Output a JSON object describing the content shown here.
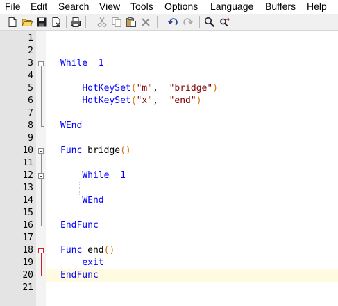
{
  "menu": [
    "File",
    "Edit",
    "Search",
    "View",
    "Tools",
    "Options",
    "Language",
    "Buffers",
    "Help"
  ],
  "toolbar": [
    {
      "icon": "new-file-icon",
      "title": "New"
    },
    {
      "icon": "open-folder-icon",
      "title": "Open"
    },
    {
      "icon": "save-icon",
      "title": "Save"
    },
    {
      "icon": "close-file-icon",
      "title": "Close"
    },
    {
      "icon": "print-icon",
      "title": "Print"
    },
    {
      "icon": "cut-icon",
      "title": "Cut"
    },
    {
      "icon": "copy-icon",
      "title": "Copy"
    },
    {
      "icon": "paste-icon",
      "title": "Paste"
    },
    {
      "icon": "delete-icon",
      "title": "Delete"
    },
    {
      "icon": "undo-icon",
      "title": "Undo"
    },
    {
      "icon": "redo-icon",
      "title": "Redo"
    },
    {
      "icon": "find-icon",
      "title": "Find"
    },
    {
      "icon": "replace-icon",
      "title": "Replace"
    }
  ],
  "editor": {
    "line_numbers": [
      "1",
      "2",
      "3",
      "4",
      "5",
      "6",
      "7",
      "8",
      "9",
      "10",
      "11",
      "12",
      "13",
      "14",
      "15",
      "16",
      "17",
      "18",
      "19",
      "20",
      "21"
    ],
    "current_line": 20,
    "lines": [
      {
        "n": 3,
        "tokens": [
          [
            "kw",
            "While"
          ],
          [
            "",
            "  "
          ],
          [
            "kw",
            "1"
          ]
        ]
      },
      {
        "n": 5,
        "tokens": [
          [
            "",
            "    "
          ],
          [
            "kw",
            "HotKeySet"
          ],
          [
            "par",
            "("
          ],
          [
            "str",
            "\"m\""
          ],
          [
            "",
            ",  "
          ],
          [
            "str",
            "\"bridge\""
          ],
          [
            "par",
            ")"
          ]
        ]
      },
      {
        "n": 6,
        "tokens": [
          [
            "",
            "    "
          ],
          [
            "kw",
            "HotKeySet"
          ],
          [
            "par",
            "("
          ],
          [
            "str",
            "\"x\""
          ],
          [
            "",
            ",  "
          ],
          [
            "str",
            "\"end\""
          ],
          [
            "par",
            ")"
          ]
        ]
      },
      {
        "n": 8,
        "tokens": [
          [
            "kw",
            "WEnd"
          ]
        ]
      },
      {
        "n": 10,
        "tokens": [
          [
            "kw",
            "Func"
          ],
          [
            "",
            " bridge"
          ],
          [
            "par",
            "()"
          ]
        ]
      },
      {
        "n": 12,
        "tokens": [
          [
            "",
            "    "
          ],
          [
            "kw",
            "While"
          ],
          [
            "",
            "  "
          ],
          [
            "kw",
            "1"
          ]
        ]
      },
      {
        "n": 14,
        "tokens": [
          [
            "",
            "    "
          ],
          [
            "kw",
            "WEnd"
          ]
        ]
      },
      {
        "n": 16,
        "tokens": [
          [
            "kw",
            "EndFunc"
          ]
        ]
      },
      {
        "n": 18,
        "tokens": [
          [
            "kw",
            "Func"
          ],
          [
            "",
            " end"
          ],
          [
            "par",
            "()"
          ]
        ]
      },
      {
        "n": 19,
        "tokens": [
          [
            "",
            "    "
          ],
          [
            "kw",
            "exit"
          ]
        ]
      },
      {
        "n": 20,
        "tokens": [
          [
            "kw",
            "EndFunc"
          ]
        ]
      }
    ]
  },
  "colors": {
    "keyword": "#0000ff",
    "string": "#800000",
    "paren": "#e07000",
    "gutter": "#e4e4e4",
    "current_line": "#fefbe0",
    "fold_active": "#d02020"
  }
}
